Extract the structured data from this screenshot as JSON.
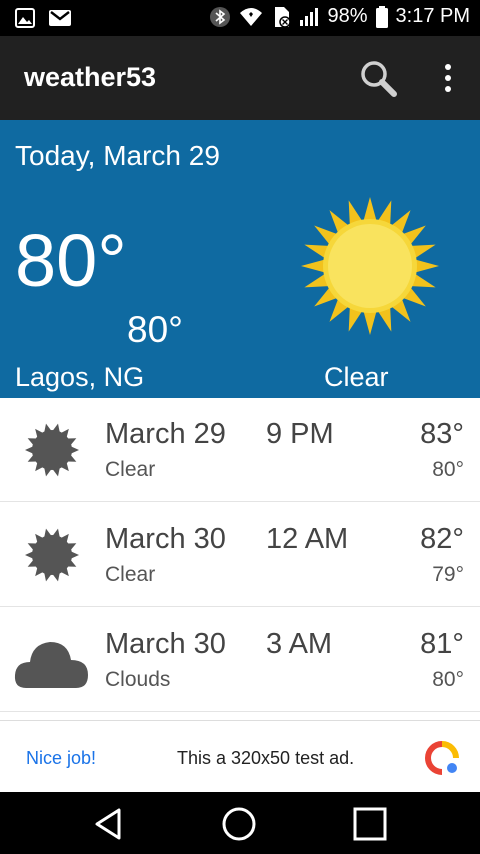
{
  "status_bar": {
    "battery": "98%",
    "time": "3:17 PM"
  },
  "app_bar": {
    "title": "weather53"
  },
  "current": {
    "date": "Today,  March 29",
    "temp": "80°",
    "low": "80°",
    "location": "Lagos, NG",
    "condition": "Clear",
    "icon": "sun-icon"
  },
  "forecast": [
    {
      "date": "March 29",
      "time": "9 PM",
      "hi": "83°",
      "condition": "Clear",
      "lo": "80°",
      "icon": "sun-icon"
    },
    {
      "date": "March 30",
      "time": "12 AM",
      "hi": "82°",
      "condition": "Clear",
      "lo": "79°",
      "icon": "sun-icon"
    },
    {
      "date": "March 30",
      "time": "3 AM",
      "hi": "81°",
      "condition": "Clouds",
      "lo": "80°",
      "icon": "cloud-icon"
    }
  ],
  "ad": {
    "left_label": "Nice job!",
    "text": "This a 320x50 test ad."
  },
  "colors": {
    "hero_bg": "#0f6aa1",
    "app_bar_bg": "#212121",
    "sun_yellow": "#f6d73a",
    "icon_gray": "#555555"
  }
}
